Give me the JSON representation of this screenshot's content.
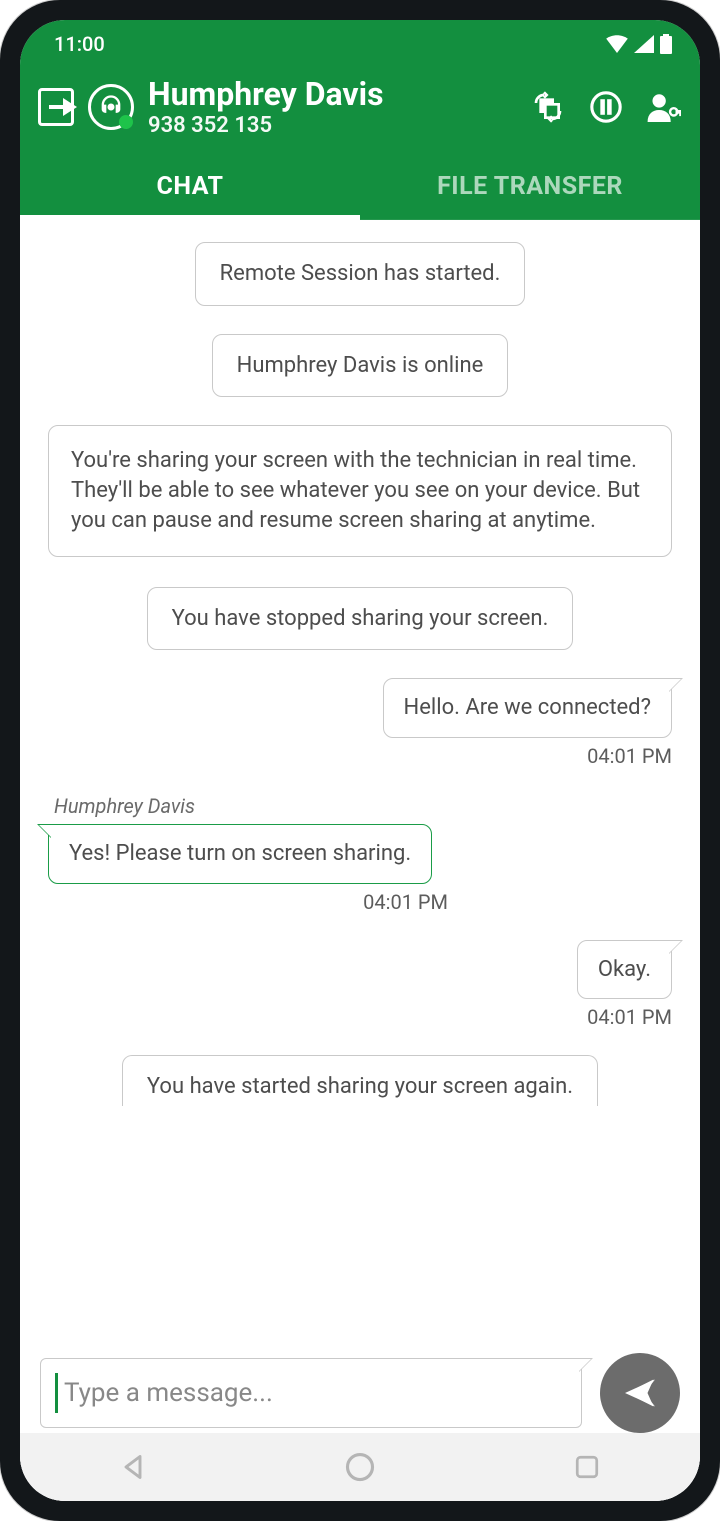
{
  "status_bar": {
    "time": "11:00"
  },
  "header": {
    "name": "Humphrey Davis",
    "session_id": "938 352 135"
  },
  "tabs": {
    "chat": "CHAT",
    "file_transfer": "FILE TRANSFER",
    "active": "chat"
  },
  "chat": {
    "system": {
      "session_started": "Remote Session has started.",
      "user_online": "Humphrey Davis is online",
      "sharing_info": "You're sharing your screen with the technician in real time. They'll be able to see whatever you see on your device. But you can pause and resume screen sharing at anytime.",
      "stopped_sharing": "You have stopped sharing your screen.",
      "started_again": "You have started sharing your screen again."
    },
    "m1": {
      "text": "Hello. Are we connected?",
      "time": "04:01 PM"
    },
    "m2": {
      "sender": "Humphrey Davis",
      "text": "Yes! Please turn on screen sharing.",
      "time": "04:01 PM"
    },
    "m3": {
      "text": "Okay.",
      "time": "04:01 PM"
    }
  },
  "input": {
    "placeholder": "Type a message..."
  }
}
